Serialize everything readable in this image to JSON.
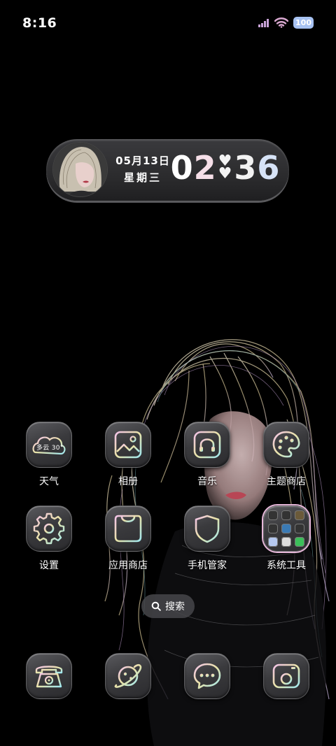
{
  "status_bar": {
    "time": "8:16",
    "battery": "100"
  },
  "clock_widget": {
    "date": "05月13日",
    "weekday": "星期三",
    "hour_1": "0",
    "hour_2": "2",
    "minute_1": "3",
    "minute_2": "6"
  },
  "apps": [
    {
      "label": "天气",
      "icon": "weather-icon",
      "weather": "多云 30°"
    },
    {
      "label": "相册",
      "icon": "gallery-icon"
    },
    {
      "label": "音乐",
      "icon": "headphones-icon"
    },
    {
      "label": "主题商店",
      "icon": "palette-icon"
    },
    {
      "label": "设置",
      "icon": "gear-icon"
    },
    {
      "label": "应用商店",
      "icon": "shopping-bag-icon"
    },
    {
      "label": "手机管家",
      "icon": "shield-icon"
    },
    {
      "label": "系统工具",
      "icon": "folder-icon"
    }
  ],
  "search": {
    "label": "搜索"
  },
  "dock": [
    {
      "icon": "phone-icon"
    },
    {
      "icon": "browser-planet-icon"
    },
    {
      "icon": "message-icon"
    },
    {
      "icon": "camera-icon"
    }
  ],
  "colors": {
    "background": "#000000",
    "icon_gradient_start": "#f2c2e8",
    "icon_gradient_mid": "#e9e3a8",
    "icon_gradient_end": "#9fe7f0",
    "battery": "#a7c2f2"
  }
}
